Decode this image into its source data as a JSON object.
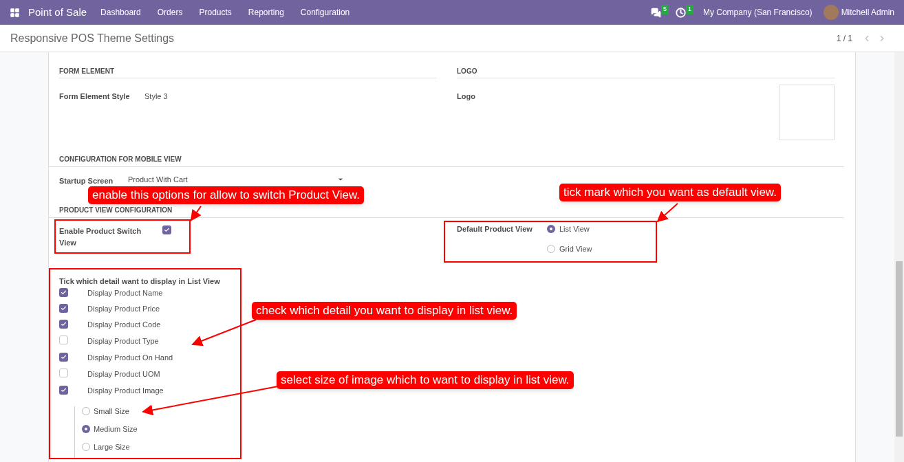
{
  "navbar": {
    "app_name": "Point of Sale",
    "menu": [
      "Dashboard",
      "Orders",
      "Products",
      "Reporting",
      "Configuration"
    ],
    "messages_count": "5",
    "activities_count": "1",
    "company": "My Company (San Francisco)",
    "user": "Mitchell Admin"
  },
  "control_panel": {
    "title": "Responsive POS Theme Settings",
    "pager": "1 / 1"
  },
  "form_element": {
    "heading": "FORM ELEMENT",
    "label": "Form Element Style",
    "value": "Style 3"
  },
  "logo": {
    "heading": "LOGO",
    "label": "Logo"
  },
  "mobile_view": {
    "heading": "CONFIGURATION FOR MOBILE VIEW",
    "label": "Startup Screen",
    "value": "Product With Cart"
  },
  "product_view": {
    "heading": "PRODUCT VIEW CONFIGURATION",
    "switch_label": "Enable Product Switch View",
    "switch_checked": true,
    "default_label": "Default Product View",
    "default_options": [
      {
        "label": "List View",
        "selected": true
      },
      {
        "label": "Grid View",
        "selected": false
      }
    ]
  },
  "list_details": {
    "heading": "Tick which detail want to display in List View",
    "items": [
      {
        "label": "Display Product Name",
        "checked": true
      },
      {
        "label": "Display Product Price",
        "checked": true
      },
      {
        "label": "Display Product Code",
        "checked": true
      },
      {
        "label": "Display Product Type",
        "checked": false
      },
      {
        "label": "Display Product On Hand",
        "checked": true
      },
      {
        "label": "Display Product UOM",
        "checked": false
      },
      {
        "label": "Display Product Image",
        "checked": true
      }
    ],
    "image_sizes": [
      {
        "label": "Small Size",
        "selected": false
      },
      {
        "label": "Medium Size",
        "selected": true
      },
      {
        "label": "Large Size",
        "selected": false
      }
    ]
  },
  "callouts": [
    "enable this options for allow to switch Product View.",
    "tick mark which you want as default view.",
    "check which detail you want to display in list view.",
    "select size of image which to want to display in list view."
  ]
}
